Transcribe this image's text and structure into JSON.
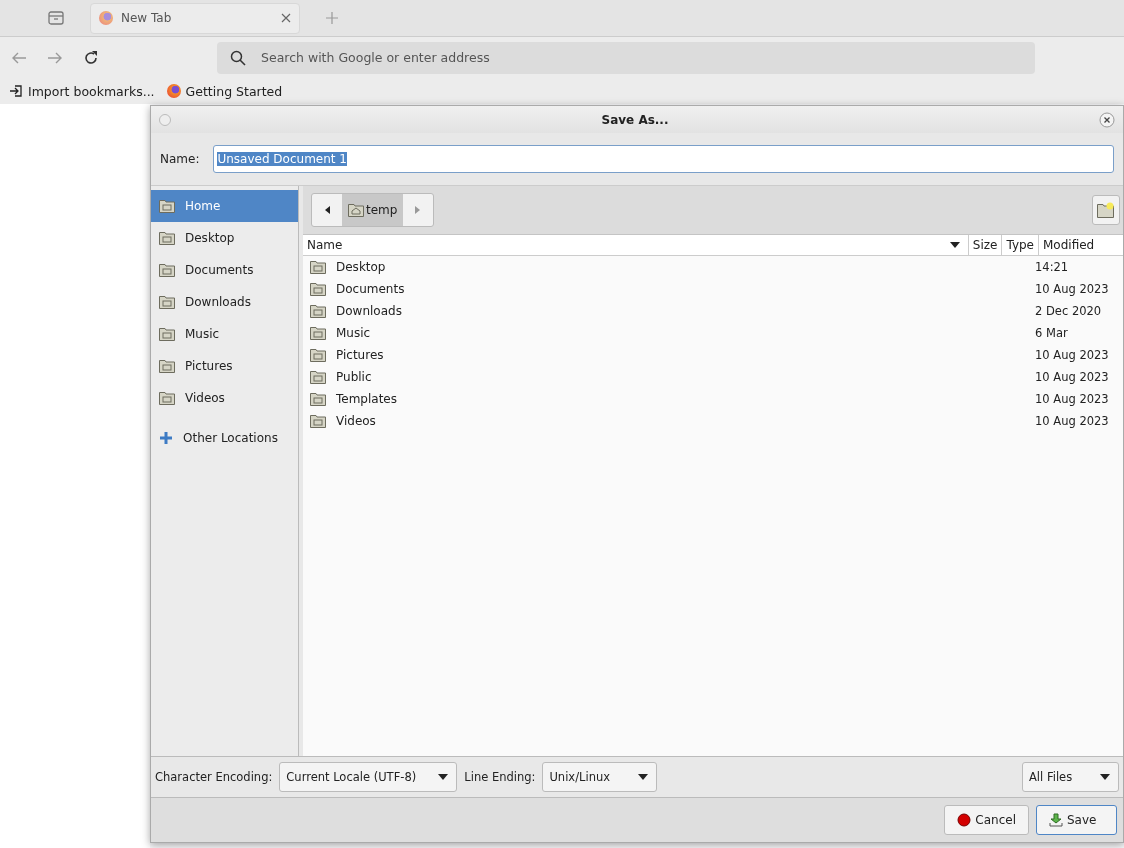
{
  "browser": {
    "tabs": [
      {
        "title": "New Tab",
        "selected": true
      }
    ],
    "address_bar": {
      "placeholder": "Search with Google or enter address"
    },
    "bookmarks": [
      {
        "kind": "import",
        "label": "Import bookmarks..."
      },
      {
        "kind": "site",
        "label": "Getting Started"
      }
    ]
  },
  "dialog": {
    "title": "Save As...",
    "name_label": "Name:",
    "name_value": "Unsaved Document 1",
    "name_text_selected": true,
    "sidebar": [
      {
        "kind": "folder",
        "label": "Home",
        "selected": true
      },
      {
        "kind": "folder",
        "label": "Desktop",
        "selected": false
      },
      {
        "kind": "folder",
        "label": "Documents",
        "selected": false
      },
      {
        "kind": "folder",
        "label": "Downloads",
        "selected": false
      },
      {
        "kind": "folder",
        "label": "Music",
        "selected": false
      },
      {
        "kind": "folder",
        "label": "Pictures",
        "selected": false
      },
      {
        "kind": "folder",
        "label": "Videos",
        "selected": false
      },
      {
        "kind": "location",
        "label": "Other Locations",
        "selected": false
      }
    ],
    "path": [
      {
        "label": "temp",
        "selected": true
      }
    ],
    "columns": [
      "Name",
      "Size",
      "Type",
      "Modified"
    ],
    "files": [
      {
        "name": "Desktop",
        "modified": "14:21"
      },
      {
        "name": "Documents",
        "modified": "10 Aug 2023"
      },
      {
        "name": "Downloads",
        "modified": "2 Dec 2020"
      },
      {
        "name": "Music",
        "modified": "6 Mar"
      },
      {
        "name": "Pictures",
        "modified": "10 Aug 2023"
      },
      {
        "name": "Public",
        "modified": "10 Aug 2023"
      },
      {
        "name": "Templates",
        "modified": "10 Aug 2023"
      },
      {
        "name": "Videos",
        "modified": "10 Aug 2023"
      }
    ],
    "encoding_label": "Character Encoding:",
    "encoding_value": "Current Locale (UTF-8)",
    "line_ending_label": "Line Ending:",
    "line_ending_value": "Unix/Linux",
    "filter_value": "All Files",
    "buttons": [
      {
        "kind": "cancel",
        "label": "Cancel"
      },
      {
        "kind": "save",
        "label": "Save"
      }
    ]
  }
}
